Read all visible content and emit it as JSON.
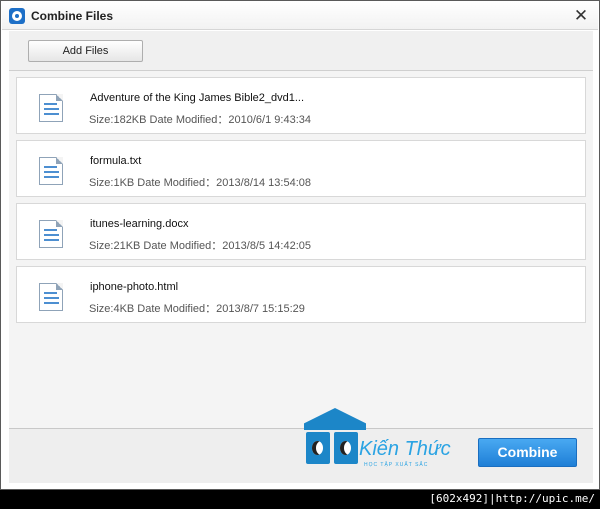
{
  "window": {
    "title": "Combine Files",
    "close_glyph": "✕"
  },
  "toolbar": {
    "add_files_label": "Add Files"
  },
  "files": [
    {
      "name": "Adventure of the King James Bible2_dvd1...",
      "meta": "Size:182KB Date Modified：2010/6/1 9:43:34",
      "icon": "document-icon"
    },
    {
      "name": "formula.txt",
      "meta": "Size:1KB Date Modified：2013/8/14 13:54:08",
      "icon": "document-icon"
    },
    {
      "name": "itunes-learning.docx",
      "meta": "Size:21KB Date Modified：2013/8/5 14:42:05",
      "icon": "document-icon"
    },
    {
      "name": "iphone-photo.html",
      "meta": "Size:4KB Date Modified：2013/8/7 15:15:29",
      "icon": "document-icon"
    }
  ],
  "footer": {
    "combine_label": "Combine"
  },
  "watermark": {
    "brand": "Kiến Thức",
    "tagline": "HỌC TẬP XUẤT SẮC"
  },
  "image_stamp": "[602x492]|http://upic.me/",
  "colors": {
    "accent": "#2a8ee0",
    "text": "#111111",
    "meta_text": "#555555"
  }
}
